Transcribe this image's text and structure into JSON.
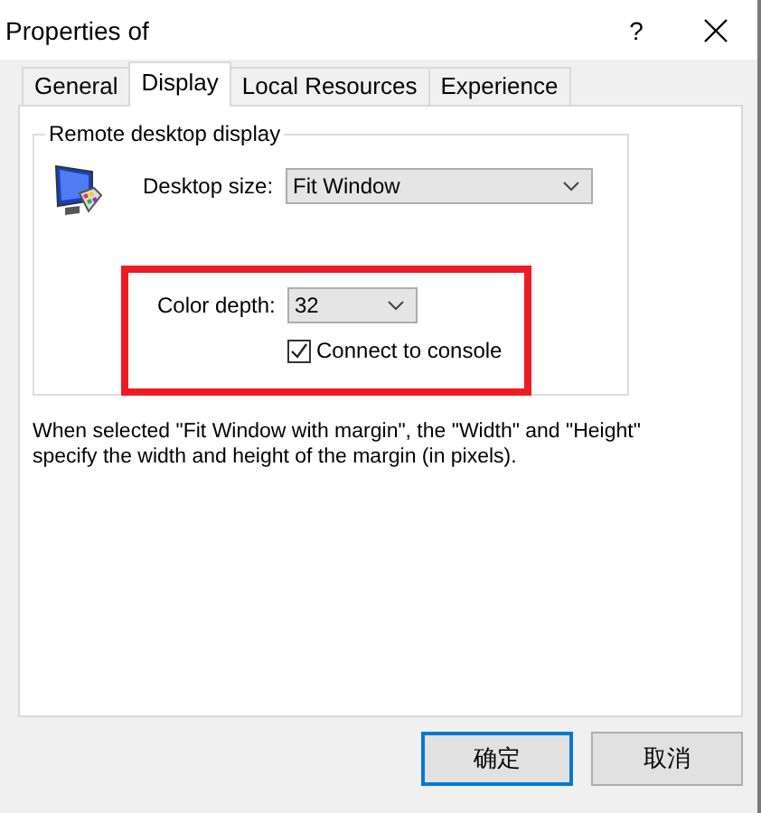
{
  "window": {
    "title": "Properties of",
    "help": "?"
  },
  "tabs": [
    {
      "label": "General",
      "selected": false
    },
    {
      "label": "Display",
      "selected": true
    },
    {
      "label": "Local Resources",
      "selected": false
    },
    {
      "label": "Experience",
      "selected": false
    }
  ],
  "display_group": {
    "title": "Remote desktop display",
    "desktop_size": {
      "label": "Desktop size:",
      "value": "Fit Window"
    },
    "color_depth": {
      "label": "Color depth:",
      "value": "32"
    },
    "connect_to_console": {
      "label": "Connect to console",
      "checked": true
    }
  },
  "description": "When selected \"Fit Window with margin\", the \"Width\" and \"Height\" specify the width and height of the margin (in pixels).",
  "buttons": [
    {
      "label": "确定",
      "default": true
    },
    {
      "label": "取消",
      "default": false
    }
  ]
}
